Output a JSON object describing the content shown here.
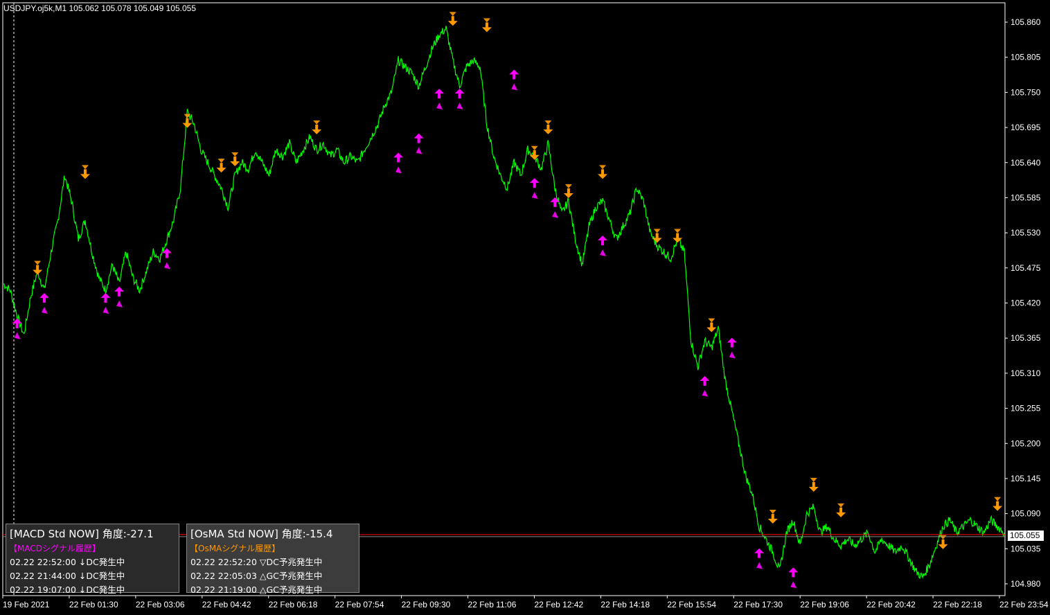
{
  "header": {
    "symbol_info": "USDJPY.oj5k,M1  105.062 105.078 105.049 105.055"
  },
  "current_price": "105.055",
  "colors": {
    "background": "#000000",
    "price_line": "#00ff00",
    "down_arrow": "#ff9900",
    "up_arrow": "#ff00ff",
    "current_line": "#ff0000",
    "axis": "#ffffff"
  },
  "panels": {
    "macd": {
      "title": "[MACD Std NOW] 角度:-27.1",
      "subtitle": "【MACDシグナル履歴】",
      "subtitle_color": "#ff00ff",
      "rows": [
        "02.22 22:52:00 ↓DC発生中",
        "02.22 21:44:00 ↓DC発生中",
        "02.22 19:07:00 ↓DC発生中"
      ]
    },
    "osma": {
      "title": "[OsMA Std NOW] 角度:-15.4",
      "subtitle": "【OsMAシグナル履歴】",
      "subtitle_color": "#ff9900",
      "rows": [
        "02.22 22:52:20 ▽DC予兆発生中",
        "02.22 22:05:03 △GC予兆発生中",
        "02.22 21:19:00 △GC予兆発生中"
      ]
    }
  },
  "chart_data": {
    "type": "line",
    "symbol": "USDJPY.oj5k",
    "timeframe": "M1",
    "y_ticks": [
      "105.860",
      "105.805",
      "105.750",
      "105.695",
      "105.640",
      "105.585",
      "105.530",
      "105.475",
      "105.420",
      "105.365",
      "105.310",
      "105.255",
      "105.200",
      "105.145",
      "105.090",
      "105.035",
      "104.980"
    ],
    "x_ticks": [
      "19 Feb 2021",
      "22 Feb 01:30",
      "22 Feb 03:06",
      "22 Feb 04:42",
      "22 Feb 06:18",
      "22 Feb 07:54",
      "22 Feb 09:30",
      "22 Feb 11:06",
      "22 Feb 12:42",
      "22 Feb 14:18",
      "22 Feb 15:54",
      "22 Feb 17:30",
      "22 Feb 19:06",
      "22 Feb 20:42",
      "22 Feb 22:18",
      "22 Feb 23:54"
    ],
    "ylim": [
      104.965,
      105.88
    ],
    "current_price": 105.055,
    "series": [
      {
        "values": [
          105.45,
          105.44,
          105.4,
          105.37,
          105.43,
          105.47,
          105.44,
          105.5,
          105.55,
          105.62,
          105.58,
          105.52,
          105.55,
          105.5,
          105.46,
          105.44,
          105.48,
          105.45,
          105.5,
          105.46,
          105.44,
          105.47,
          105.5,
          105.49,
          105.52,
          105.55,
          105.6,
          105.72,
          105.7,
          105.66,
          105.64,
          105.62,
          105.6,
          105.57,
          105.62,
          105.64,
          105.63,
          105.66,
          105.64,
          105.62,
          105.66,
          105.65,
          105.67,
          105.64,
          105.66,
          105.68,
          105.66,
          105.67,
          105.65,
          105.66,
          105.64,
          105.65,
          105.64,
          105.66,
          105.68,
          105.7,
          105.73,
          105.75,
          105.8,
          105.79,
          105.78,
          105.76,
          105.79,
          105.82,
          105.84,
          105.85,
          105.8,
          105.76,
          105.79,
          105.8,
          105.79,
          105.7,
          105.65,
          105.62,
          105.6,
          105.64,
          105.62,
          105.66,
          105.65,
          105.63,
          105.67,
          105.6,
          105.56,
          105.58,
          105.52,
          105.48,
          105.54,
          105.57,
          105.58,
          105.55,
          105.52,
          105.54,
          105.56,
          105.6,
          105.58,
          105.53,
          105.51,
          105.5,
          105.49,
          105.52,
          105.5,
          105.36,
          105.32,
          105.36,
          105.35,
          105.38,
          105.3,
          105.25,
          105.2,
          105.15,
          105.12,
          105.07,
          105.05,
          105.03,
          105.0,
          105.06,
          105.08,
          105.04,
          105.09,
          105.1,
          105.06,
          105.07,
          105.05,
          105.04,
          105.05,
          105.04,
          105.05,
          105.06,
          105.03,
          105.05,
          105.04,
          105.03,
          105.04,
          105.02,
          105.0,
          104.99,
          105.01,
          105.04,
          105.07,
          105.08,
          105.06,
          105.07,
          105.08,
          105.07,
          105.06,
          105.08,
          105.07,
          105.06
        ]
      }
    ],
    "markers_down": [
      {
        "i": 5,
        "v": 105.46
      },
      {
        "i": 12,
        "v": 105.61
      },
      {
        "i": 27,
        "v": 105.69
      },
      {
        "i": 32,
        "v": 105.62
      },
      {
        "i": 34,
        "v": 105.63
      },
      {
        "i": 46,
        "v": 105.68
      },
      {
        "i": 66,
        "v": 105.85
      },
      {
        "i": 71,
        "v": 105.84
      },
      {
        "i": 78,
        "v": 105.64
      },
      {
        "i": 80,
        "v": 105.68
      },
      {
        "i": 83,
        "v": 105.58
      },
      {
        "i": 88,
        "v": 105.61
      },
      {
        "i": 96,
        "v": 105.51
      },
      {
        "i": 99,
        "v": 105.51
      },
      {
        "i": 104,
        "v": 105.37
      },
      {
        "i": 113,
        "v": 105.07
      },
      {
        "i": 119,
        "v": 105.12
      },
      {
        "i": 123,
        "v": 105.08
      },
      {
        "i": 138,
        "v": 105.03
      },
      {
        "i": 146,
        "v": 105.09
      }
    ],
    "markers_up": [
      {
        "i": 2,
        "v": 105.4
      },
      {
        "i": 6,
        "v": 105.44
      },
      {
        "i": 15,
        "v": 105.44
      },
      {
        "i": 17,
        "v": 105.45
      },
      {
        "i": 24,
        "v": 105.51
      },
      {
        "i": 58,
        "v": 105.66
      },
      {
        "i": 61,
        "v": 105.69
      },
      {
        "i": 64,
        "v": 105.76
      },
      {
        "i": 67,
        "v": 105.76
      },
      {
        "i": 75,
        "v": 105.79
      },
      {
        "i": 78,
        "v": 105.62
      },
      {
        "i": 81,
        "v": 105.59
      },
      {
        "i": 88,
        "v": 105.53
      },
      {
        "i": 103,
        "v": 105.31
      },
      {
        "i": 107,
        "v": 105.37
      },
      {
        "i": 111,
        "v": 105.04
      },
      {
        "i": 116,
        "v": 105.01
      }
    ]
  }
}
